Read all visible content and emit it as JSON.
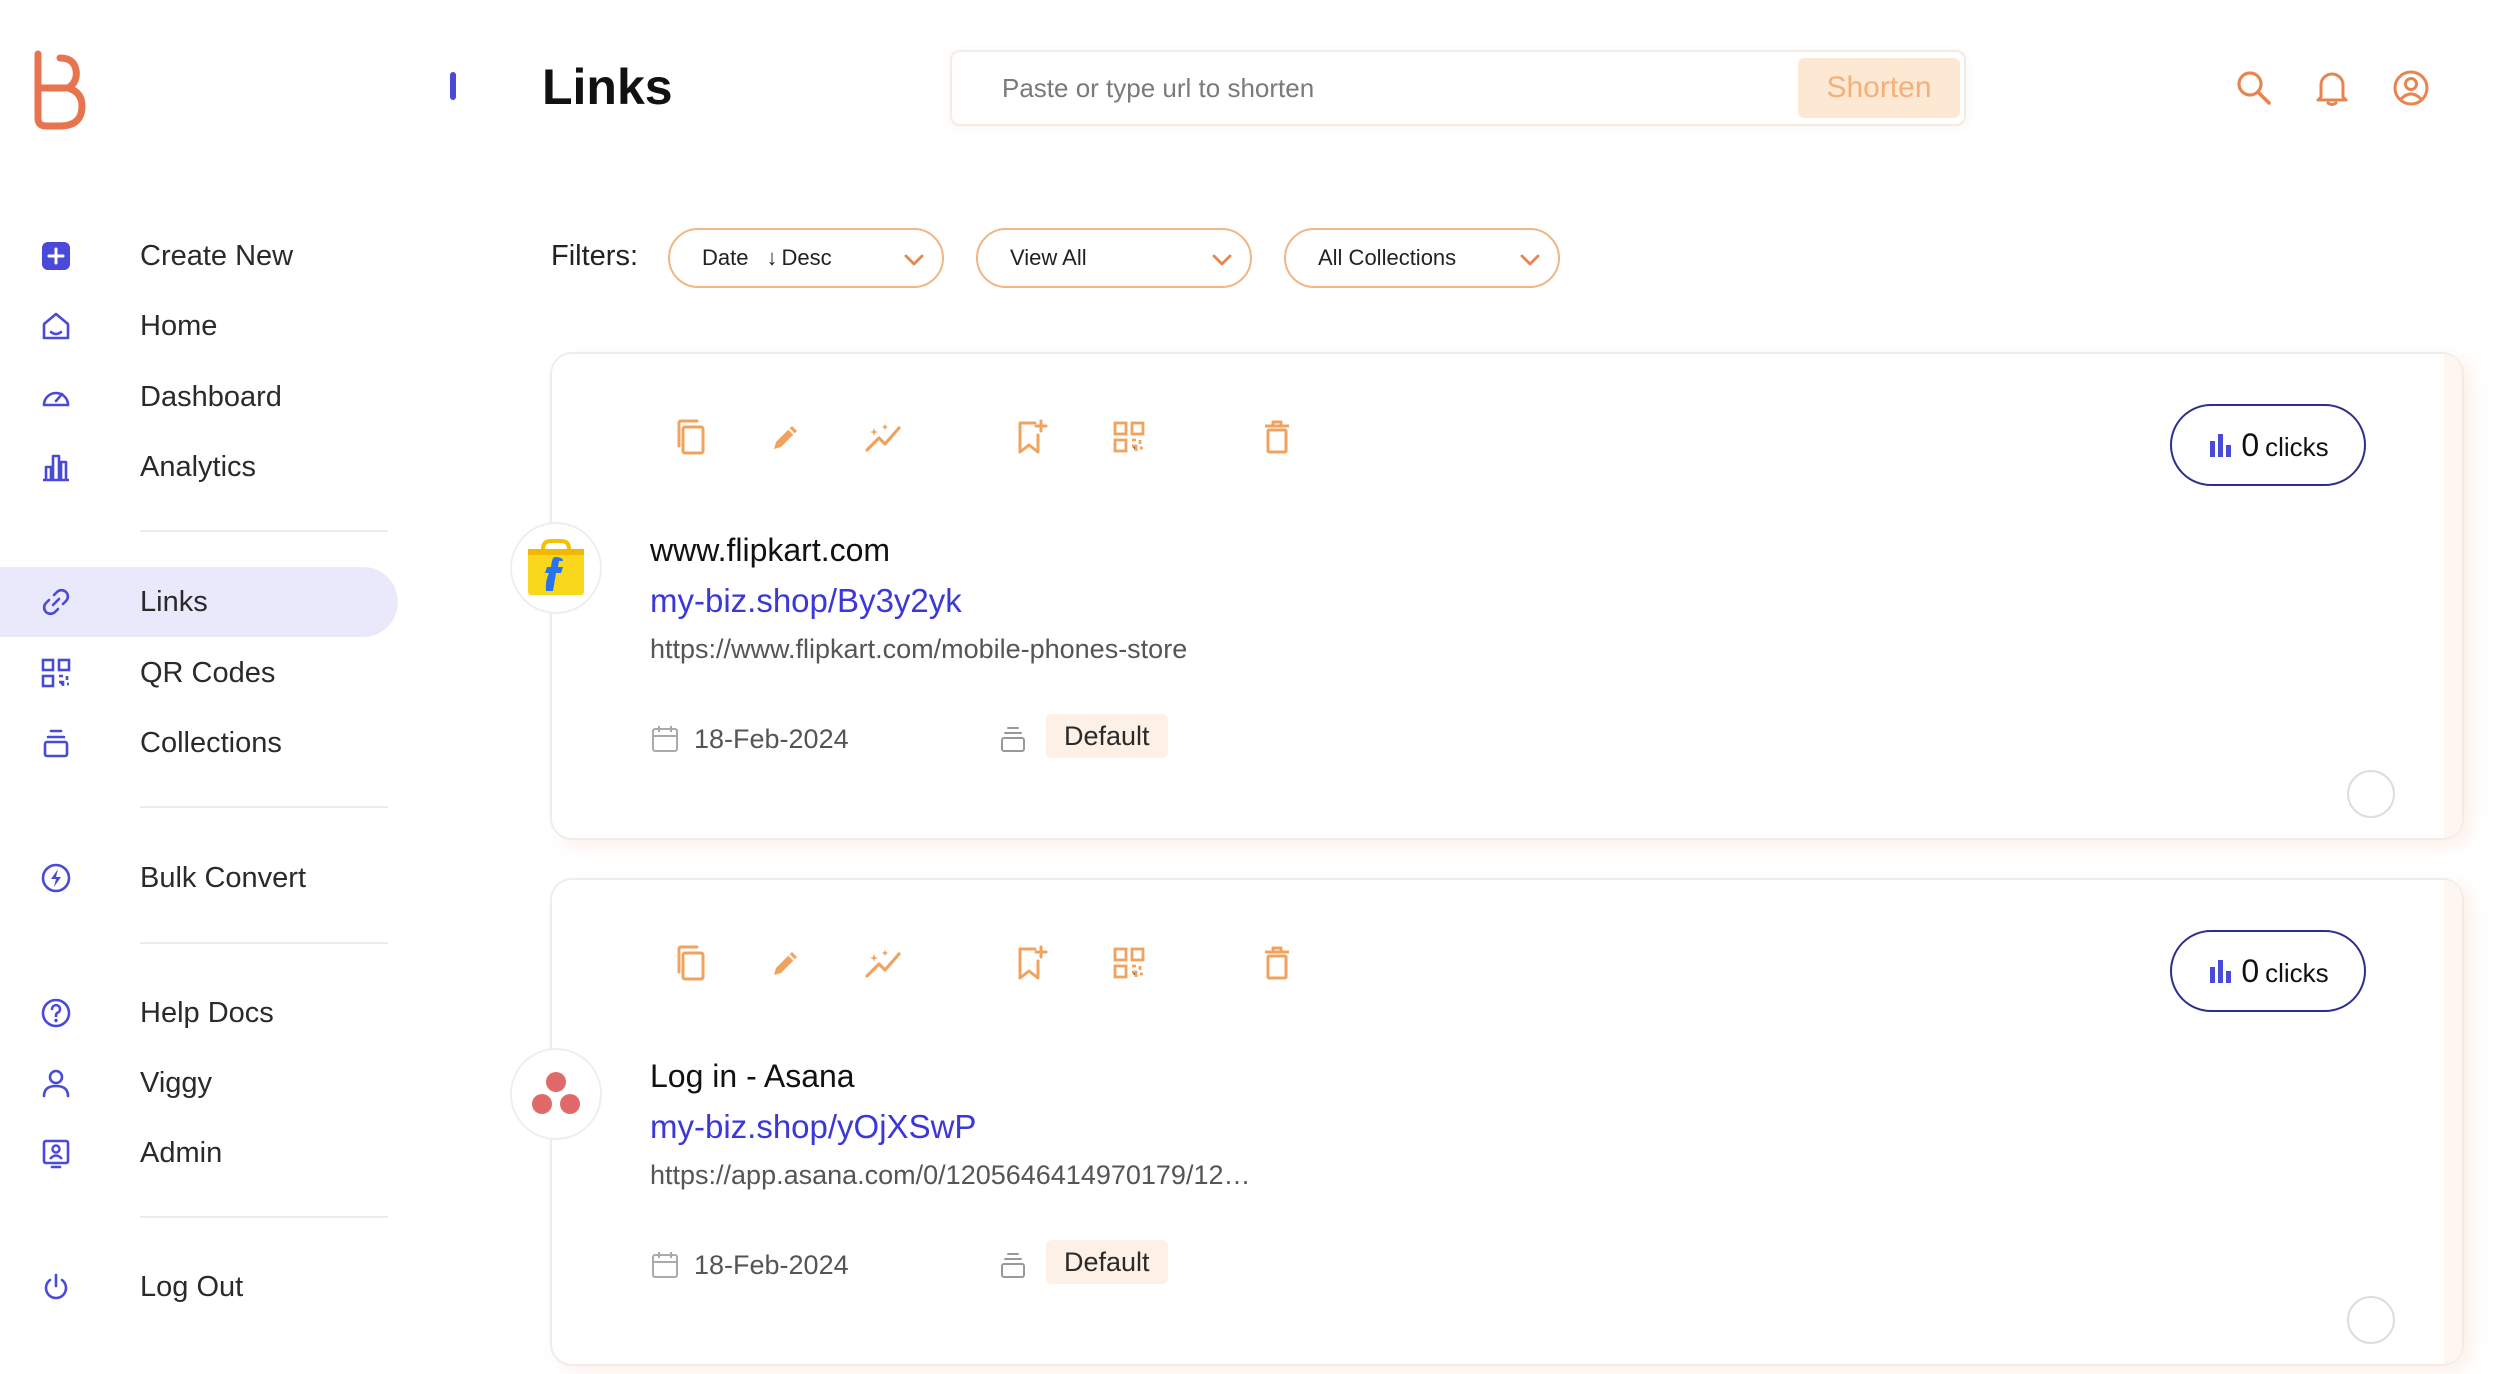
{
  "colors": {
    "accent": "#4a4ad9",
    "brand": "#e8844f",
    "orange": "#f0a35e",
    "link": "#3b37d8"
  },
  "header": {
    "title": "Links",
    "search_placeholder": "Paste or type url to shorten",
    "shorten_label": "Shorten",
    "icons": [
      "search-icon",
      "bell-icon",
      "user-circle-icon"
    ]
  },
  "sidebar": {
    "items": [
      {
        "label": "Create New",
        "icon": "plus-square-icon"
      },
      {
        "label": "Home",
        "icon": "home-icon"
      },
      {
        "label": "Dashboard",
        "icon": "speedometer-icon"
      },
      {
        "label": "Analytics",
        "icon": "bar-chart-icon"
      },
      {
        "label": "Links",
        "icon": "link-icon",
        "active": true
      },
      {
        "label": "QR Codes",
        "icon": "qr-code-icon"
      },
      {
        "label": "Collections",
        "icon": "stack-icon"
      },
      {
        "label": "Bulk Convert",
        "icon": "lightning-icon"
      },
      {
        "label": "Help Docs",
        "icon": "help-circle-icon"
      },
      {
        "label": "Viggy",
        "icon": "user-icon"
      },
      {
        "label": "Admin",
        "icon": "admin-badge-icon"
      },
      {
        "label": "Log Out",
        "icon": "power-icon"
      }
    ]
  },
  "filters": {
    "label": "Filters:",
    "date": {
      "field": "Date",
      "order": "Desc"
    },
    "view": "View All",
    "collections": "All Collections"
  },
  "links": [
    {
      "title": "www.flipkart.com",
      "short_url": "my-biz.shop/By3y2yk",
      "long_url": "https://www.flipkart.com/mobile-phones-store",
      "date": "18-Feb-2024",
      "collection": "Default",
      "clicks": "0",
      "clicks_label": "clicks",
      "favicon": "flipkart-logo-icon"
    },
    {
      "title": "Log in - Asana",
      "short_url": "my-biz.shop/yOjXSwP",
      "long_url": "https://app.asana.com/0/1205646414970179/12…",
      "date": "18-Feb-2024",
      "collection": "Default",
      "clicks": "0",
      "clicks_label": "clicks",
      "favicon": "asana-logo-icon"
    }
  ]
}
